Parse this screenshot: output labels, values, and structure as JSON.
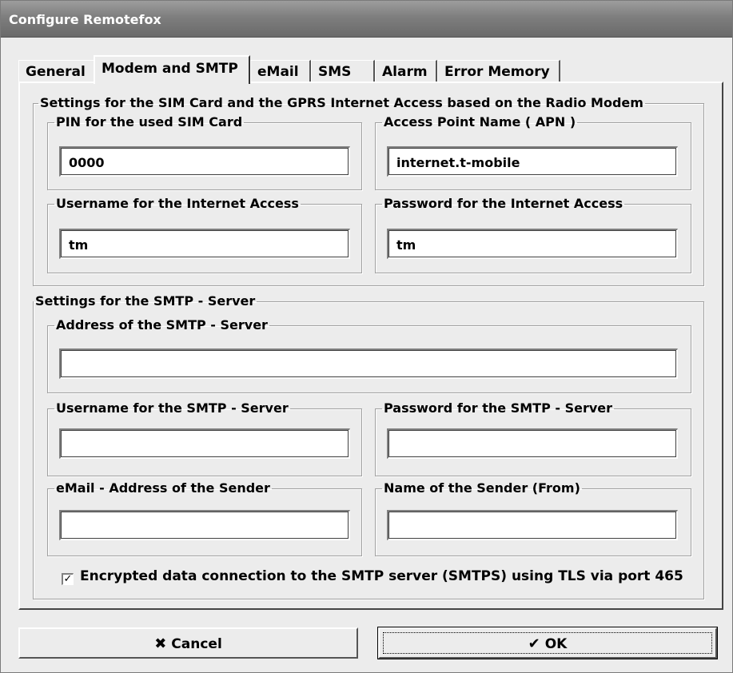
{
  "window": {
    "title": "Configure Remotefox"
  },
  "tabs": [
    {
      "label": "General"
    },
    {
      "label": "Modem and SMTP"
    },
    {
      "label": "eMail"
    },
    {
      "label": "SMS"
    },
    {
      "label": "Alarm"
    },
    {
      "label": "Error Memory"
    }
  ],
  "sim_group": {
    "title": "Settings for the SIM Card and the GPRS Internet Access based on the Radio Modem",
    "pin": {
      "label": "PIN for the used SIM Card",
      "value": "0000"
    },
    "apn": {
      "label": "Access Point Name ( APN )",
      "value": "internet.t-mobile"
    },
    "username": {
      "label": "Username for the Internet Access",
      "value": "tm"
    },
    "password": {
      "label": "Password for the Internet Access",
      "value": "tm"
    }
  },
  "smtp_group": {
    "title": "Settings for the SMTP - Server",
    "address": {
      "label": "Address of the SMTP - Server",
      "value": ""
    },
    "username": {
      "label": "Username for the SMTP - Server",
      "value": ""
    },
    "password": {
      "label": "Password for the SMTP - Server",
      "value": ""
    },
    "sender_email": {
      "label": "eMail - Address of the Sender",
      "value": ""
    },
    "sender_name": {
      "label": "Name of the Sender (From)",
      "value": ""
    },
    "tls_checkbox": {
      "label": "Encrypted data connection to the SMTP server (SMTPS) using TLS via port 465",
      "checked": true,
      "mark": "✓"
    }
  },
  "buttons": {
    "cancel": {
      "label": "Cancel",
      "icon": "✖"
    },
    "ok": {
      "label": "OK",
      "icon": "✔"
    }
  }
}
